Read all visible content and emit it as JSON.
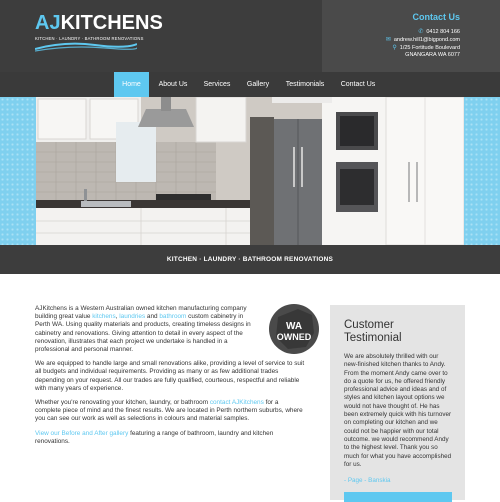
{
  "logo": {
    "aj": "AJ",
    "kitchens": "KITCHENS",
    "tagline": "KITCHEN · LAUNDRY · BATHROOM RENOVATIONS"
  },
  "contact": {
    "title": "Contact Us",
    "phone": "0412 804 166",
    "email": "andrew.hill1@bigpond.com",
    "address1": "1/25 Fortitude Boulevard",
    "address2": "GNANGARA WA 6077"
  },
  "nav": {
    "items": [
      "Home",
      "About Us",
      "Services",
      "Gallery",
      "Testimonials",
      "Contact Us"
    ],
    "active": "Home"
  },
  "banner": {
    "text": "KITCHEN  ·  LAUNDRY  ·  BATHROOM RENOVATIONS"
  },
  "content": {
    "p1_a": "AJKitchens is a Western Australian owned kitchen manufacturing company building great value ",
    "p1_link1": "kitchens",
    "p1_b": ", ",
    "p1_link2": "laundries",
    "p1_c": " and ",
    "p1_link3": "bathroom",
    "p1_d": " custom cabinetry in Perth WA. Using quality materials and products, creating timeless designs in cabinetry and renovations. Giving attention to detail in every aspect of the renovation, illustrates that each project we undertake is handled in a professional and personal manner.",
    "p2": "We are equipped to handle large and small renovations alike, providing a level of service to suit all budgets and individual requirements. Providing as many or as few additional trades depending on your request. All our trades are fully qualified, courteous, respectful and reliable with many years of experience.",
    "p3_a": "Whether you're renovating your kitchen, laundry, or bathroom ",
    "p3_link": "contact AJKitchens",
    "p3_b": " for a complete piece of mind and the finest results. We are located in Perth northern suburbs, where you can see our work as well as selections in colours and material samples.",
    "p4_link": "View our Before and After gallery",
    "p4_b": " featuring a range of bathroom, laundry and kitchen renovations."
  },
  "badge": {
    "line1": "WA",
    "line2": "OWNED"
  },
  "testimonial": {
    "title": "Customer Testimonial",
    "body": "We are absolutely thrilled with our new-finished kitchen thanks to Andy. From the moment Andy came over to do a quote for us, he offered friendly professional advice and ideas and of styles and kitchen layout options we would not have thought of. He has been extremely quick with his turnover on completing our kitchen and we could not be happier with our total outcome. we would recommend Andy to the highest level. Thank you so much for what you have accomplished for us.",
    "author": "- Page - Banskia"
  },
  "colors": {
    "accent": "#5ec8f0",
    "dark": "#3d3d3d",
    "panel": "#e4e4e4"
  }
}
